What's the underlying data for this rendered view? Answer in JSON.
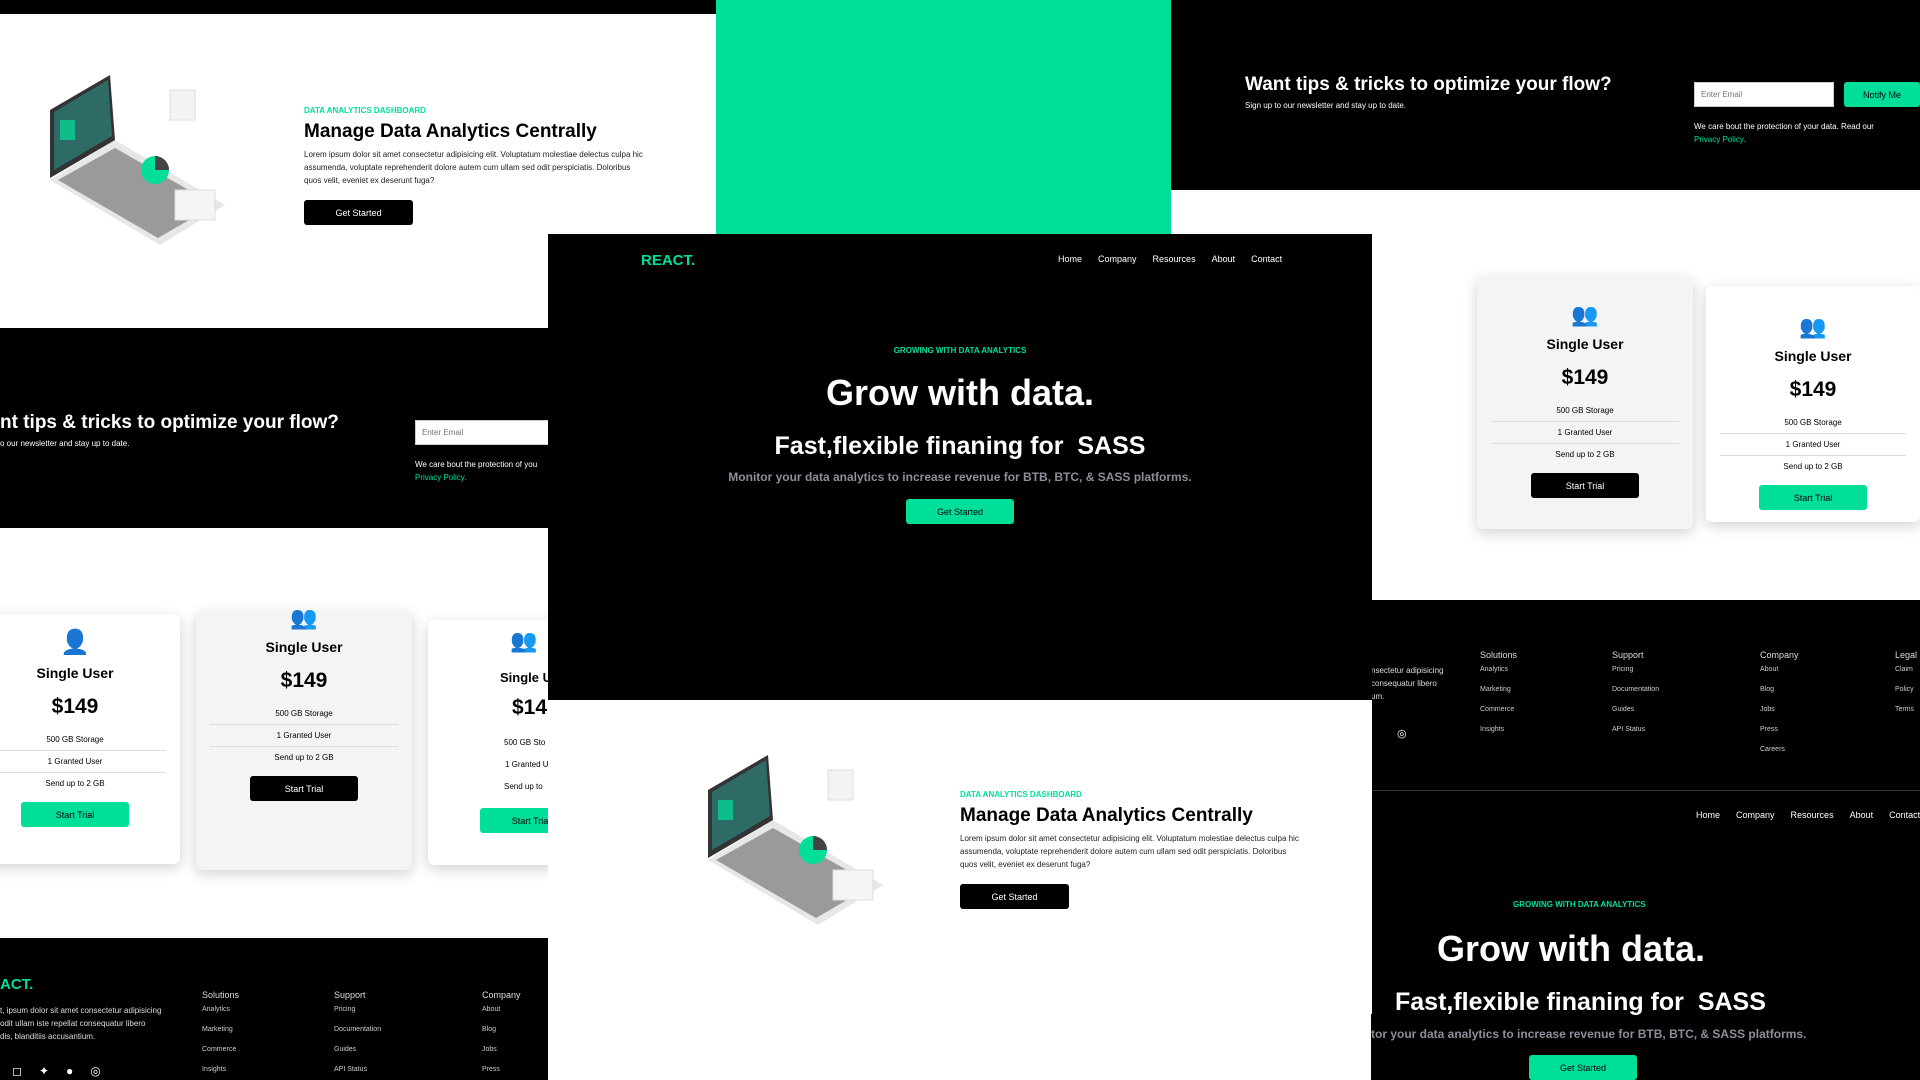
{
  "brand": {
    "logo": "REACT.",
    "accent": "#00df9a"
  },
  "nav": {
    "links": [
      "Home",
      "Company",
      "Resources",
      "About",
      "Contact"
    ]
  },
  "hero": {
    "kicker": "GROWING WITH DATA ANALYTICS",
    "title": "Grow with data.",
    "subtitle": "Fast,flexible finaning for",
    "subtitle_word": "SASS",
    "tagline": "Monitor your data analytics to increase revenue for BTB, BTC, & SASS platforms.",
    "button": "Get Started"
  },
  "analytics": {
    "kicker": "DATA ANALYTICS DASHBOARD",
    "title": "Manage Data Analytics Centrally",
    "body": "Lorem ipsum dolor sit amet consectetur adipisicing elit. Voluptatum molestiae delectus culpa hic assumenda, voluptate reprehenderit dolore autem cum ullam sed odit perspiciatis. Doloribus quos velit, eveniet ex deserunt fuga?",
    "button": "Get Started"
  },
  "newsletter": {
    "title": "Want tips & tricks to optimize your flow?",
    "title_cut": "nt tips & tricks to optimize your flow?",
    "subtitle": "Sign up to our newsletter and stay up to date.",
    "subtitle_cut": "o our newsletter and stay up to date.",
    "placeholder": "Enter Email",
    "button": "Notify Me",
    "note": "We care bout the protection of your data. Read our",
    "note_cut": "We care bout the protection of you",
    "link": "Privacy Policy."
  },
  "pricing": {
    "cards": [
      {
        "title": "Single User",
        "price": "$149",
        "features": [
          "500 GB Storage",
          "1 Granted User",
          "Send up to 2 GB"
        ],
        "button": "Start Trial"
      },
      {
        "title": "Single User",
        "price": "$149",
        "features": [
          "500 GB Storage",
          "1 Granted User",
          "Send up to 2 GB"
        ],
        "button": "Start Trial"
      },
      {
        "title": "Single User",
        "price": "$149",
        "features": [
          "500 GB Storage",
          "1 Granted User",
          "Send up to 2 GB"
        ],
        "button": "Start Trial"
      }
    ],
    "cut": {
      "title": "Single U",
      "price": "$14",
      "f1": "500 GB Sto",
      "f2": "1 Granted U",
      "f3": "Send up to",
      "button": "Start Tria",
      "r_title": "ser",
      "r_f1": "ge",
      "r_f2": "er",
      "r_f3": "GB"
    }
  },
  "footer": {
    "about": "t, ipsum dolor sit amet consectetur adipisicing",
    "about2": "odit ullam iste repellat consequatur libero",
    "about3": "dis, blanditiis accusantium.",
    "about_r1": "nsectetur adipisicing",
    "about_r2": "consequatur libero",
    "about_r3": "um.",
    "logo_cut": "ACT.",
    "columns": [
      {
        "heading": "Solutions",
        "items": [
          "Analytics",
          "Marketing",
          "Commerce",
          "Insights"
        ]
      },
      {
        "heading": "Support",
        "items": [
          "Pricing",
          "Documentation",
          "Guides",
          "API Status"
        ]
      },
      {
        "heading": "Company",
        "items": [
          "About",
          "Blog",
          "Jobs",
          "Press",
          "Careers"
        ]
      },
      {
        "heading": "Legal",
        "items": [
          "Claim",
          "Policy",
          "Terms"
        ]
      }
    ],
    "social_icons": [
      "instagram-icon",
      "twitter-icon",
      "github-icon",
      "dribbble-icon"
    ]
  }
}
